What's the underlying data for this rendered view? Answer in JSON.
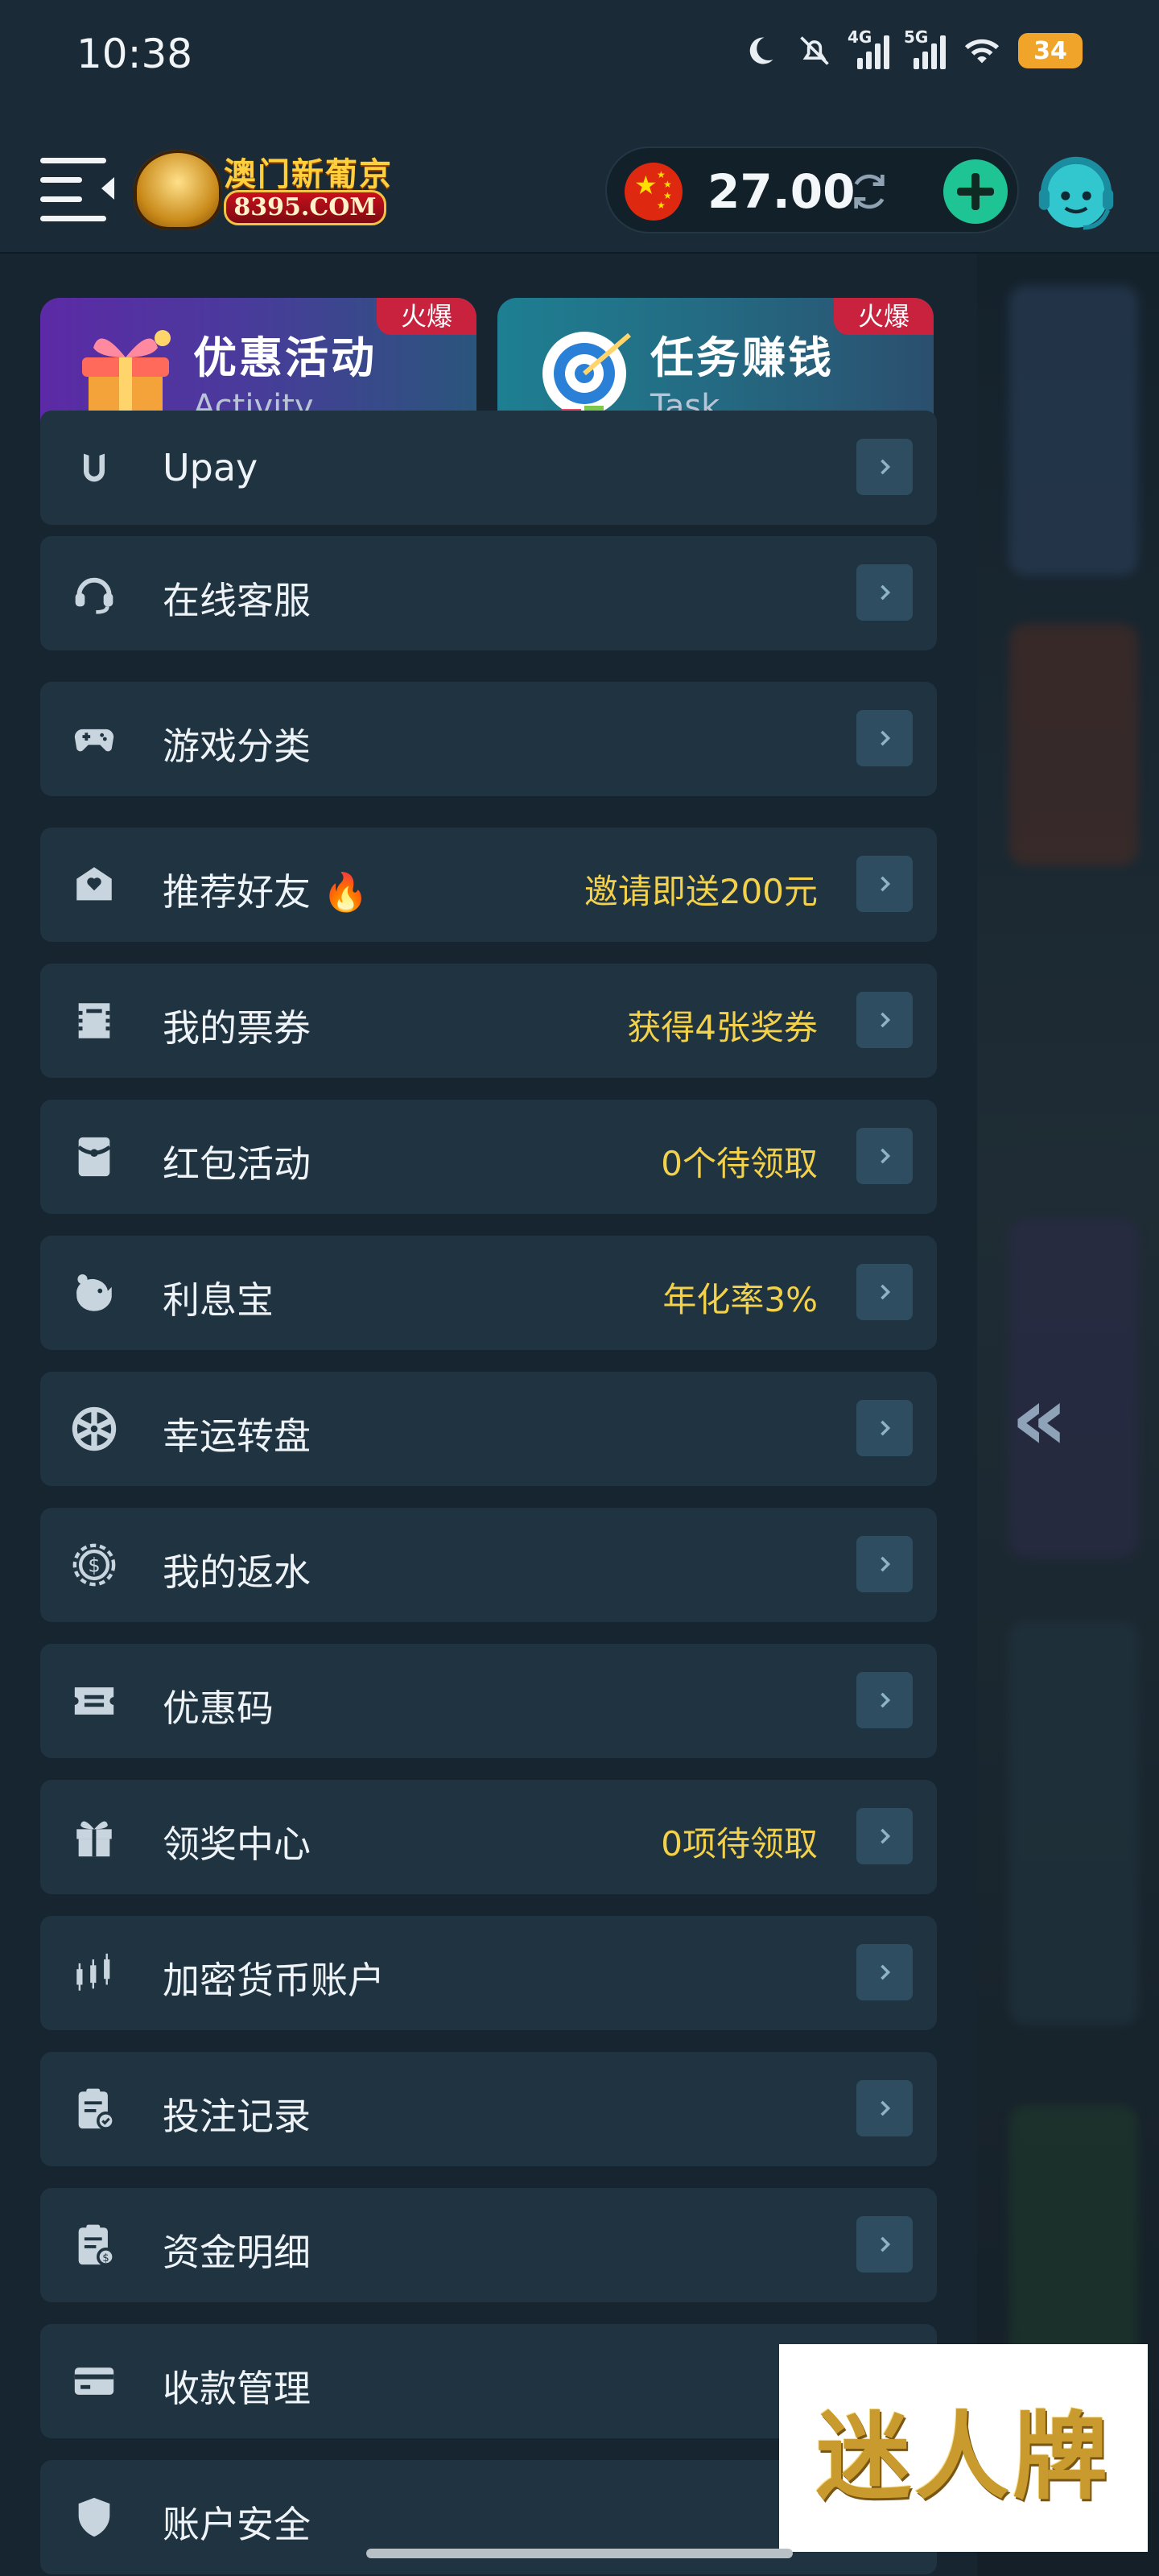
{
  "status_bar": {
    "time": "10:38",
    "net1": "4G",
    "net2": "5G",
    "battery": "34"
  },
  "header": {
    "logo_cn": "澳门新葡京",
    "logo_url": "8395.COM",
    "balance": "27.00"
  },
  "promos": [
    {
      "title": "优惠活动",
      "subtitle": "Activity",
      "badge": "火爆"
    },
    {
      "title": "任务赚钱",
      "subtitle": "Task",
      "badge": "火爆"
    }
  ],
  "menu": [
    {
      "label": "Upay",
      "note": "",
      "icon": "upay-icon"
    },
    {
      "label": "在线客服",
      "note": "",
      "icon": "headset-icon"
    },
    {
      "label": "游戏分类",
      "note": "",
      "icon": "gamepad-icon"
    },
    {
      "label": "推荐好友 🔥",
      "note": "邀请即送200元",
      "icon": "referral-icon"
    },
    {
      "label": "我的票券",
      "note": "获得4张奖券",
      "icon": "ticket-icon"
    },
    {
      "label": "红包活动",
      "note": "0个待领取",
      "icon": "red-envelope-icon"
    },
    {
      "label": "利息宝",
      "note": "年化率3%",
      "icon": "piggy-bank-icon"
    },
    {
      "label": "幸运转盘",
      "note": "",
      "icon": "wheel-icon"
    },
    {
      "label": "我的返水",
      "note": "",
      "icon": "cashback-icon"
    },
    {
      "label": "优惠码",
      "note": "",
      "icon": "coupon-code-icon"
    },
    {
      "label": "领奖中心",
      "note": "0项待领取",
      "icon": "gift-icon"
    },
    {
      "label": "加密货币账户",
      "note": "",
      "icon": "crypto-icon"
    },
    {
      "label": "投注记录",
      "note": "",
      "icon": "bet-record-icon"
    },
    {
      "label": "资金明细",
      "note": "",
      "icon": "fund-detail-icon"
    },
    {
      "label": "收款管理",
      "note": "",
      "icon": "card-icon"
    },
    {
      "label": "账户安全",
      "note": "",
      "icon": "shield-icon"
    }
  ],
  "watermark": "迷人牌",
  "colors": {
    "accent_green": "#1fc495",
    "note_yellow": "#f3d14a",
    "hot_red": "#c9223e"
  }
}
